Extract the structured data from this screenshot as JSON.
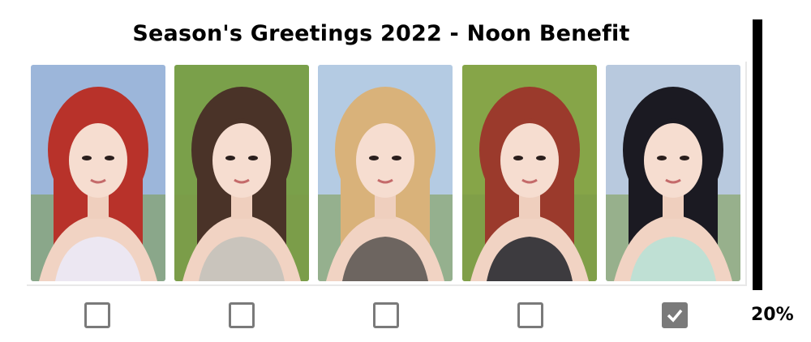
{
  "title": "Season's Greetings 2022 - Noon Benefit",
  "photos": [
    {
      "icon": "photo-red-hair-member",
      "hair": "#b8322a",
      "sky": "#9cb6da",
      "top": "#ece7f2",
      "selected": false
    },
    {
      "icon": "photo-braided-hair-member",
      "hair": "#4a3328",
      "sky": "#7aa04a",
      "top": "#c9c4bc",
      "selected": false
    },
    {
      "icon": "photo-blonde-hair-member",
      "hair": "#d9b27a",
      "sky": "#b4cbe3",
      "top": "#6d6560",
      "selected": false
    },
    {
      "icon": "photo-auburn-hair-member",
      "hair": "#9b3a2c",
      "sky": "#86a548",
      "top": "#3d3b3f",
      "selected": false
    },
    {
      "icon": "photo-black-hair-member",
      "hair": "#1b1a22",
      "sky": "#b8c9de",
      "top": "#bfe0d4",
      "selected": true
    }
  ],
  "progress": {
    "label": "20%",
    "value": 0.2
  },
  "colors": {
    "checkbox": "#7a7a7a",
    "bar": "#000000"
  }
}
